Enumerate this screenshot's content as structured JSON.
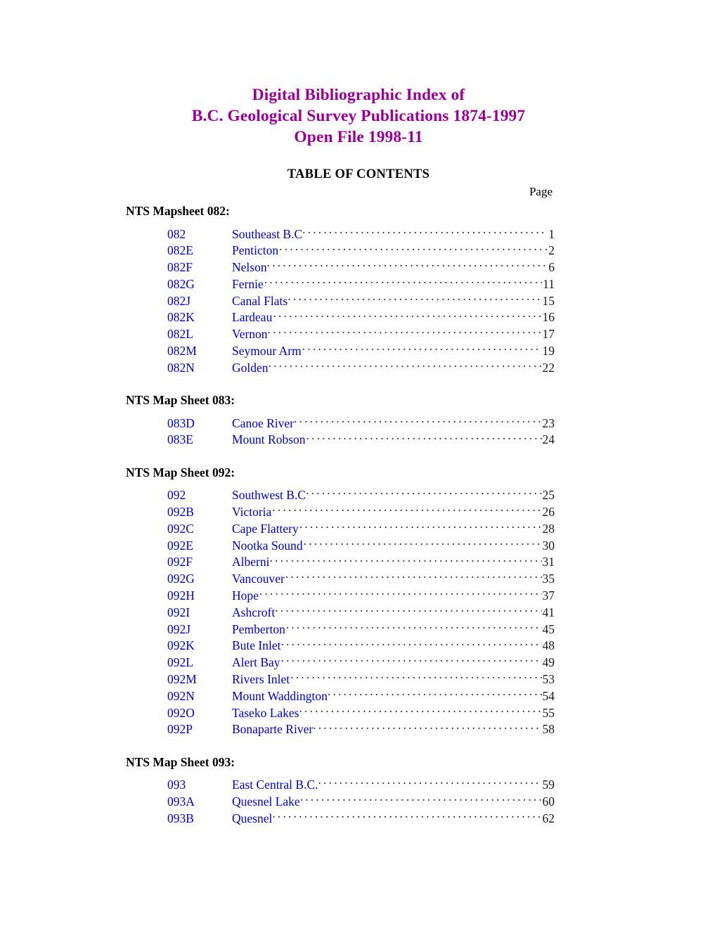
{
  "document": {
    "title_lines": [
      "Digital Bibliographic Index of",
      "B.C. Geological Survey Publications 1874-1997",
      "Open File 1998-11"
    ],
    "toc_heading": "TABLE OF CONTENTS",
    "page_column_label": "Page",
    "colors": {
      "title": "#990099",
      "link": "#0000CC",
      "text": "#000000",
      "leader": "#2B2B2B"
    }
  },
  "sections": [
    {
      "heading": "NTS Mapsheet  082:",
      "entries": [
        {
          "code": "082",
          "name": "Southeast B.C",
          "leader_space": false,
          "page": "1"
        },
        {
          "code": "082E",
          "name": "Penticton",
          "leader_space": true,
          "page": "2"
        },
        {
          "code": "082F",
          "name": "Nelson",
          "leader_space": false,
          "page": "6"
        },
        {
          "code": "082G",
          "name": "Fernie",
          "leader_space": true,
          "page": "11"
        },
        {
          "code": "082J",
          "name": "Canal Flats",
          "leader_space": false,
          "page": "15"
        },
        {
          "code": "082K",
          "name": "Lardeau",
          "leader_space": true,
          "page": "16"
        },
        {
          "code": "082L",
          "name": "Vernon",
          "leader_space": false,
          "page": "17"
        },
        {
          "code": "082M",
          "name": "Seymour Arm",
          "leader_space": true,
          "page": "19"
        },
        {
          "code": "082N",
          "name": "Golden",
          "leader_space": false,
          "page": "22"
        }
      ]
    },
    {
      "heading": "NTS Map Sheet  083:",
      "entries": [
        {
          "code": "083D",
          "name": "Canoe River",
          "leader_space": false,
          "page": "23"
        },
        {
          "code": "083E",
          "name": "Mount Robson",
          "leader_space": true,
          "page": "24"
        }
      ]
    },
    {
      "heading": "NTS Map Sheet  092:",
      "entries": [
        {
          "code": "092",
          "name": "Southwest B.C",
          "leader_space": false,
          "page": "25"
        },
        {
          "code": "092B",
          "name": "Victoria",
          "leader_space": true,
          "page": "26"
        },
        {
          "code": "092C",
          "name": "Cape Flattery",
          "leader_space": true,
          "page": "28"
        },
        {
          "code": "092E",
          "name": "Nootka Sound",
          "leader_space": true,
          "page": "30"
        },
        {
          "code": "092F",
          "name": "Alberni",
          "leader_space": false,
          "page": "31"
        },
        {
          "code": "092G",
          "name": "Vancouver",
          "leader_space": true,
          "page": "35"
        },
        {
          "code": "092H",
          "name": "Hope",
          "leader_space": true,
          "page": "37"
        },
        {
          "code": "092I",
          "name": "Ashcroft",
          "leader_space": false,
          "page": "41"
        },
        {
          "code": "092J",
          "name": "Pemberton",
          "leader_space": true,
          "page": "45"
        },
        {
          "code": "092K",
          "name": "Bute Inlet",
          "leader_space": false,
          "page": "48"
        },
        {
          "code": "092L",
          "name": "Alert Bay",
          "leader_space": true,
          "page": "49"
        },
        {
          "code": "092M",
          "name": "Rivers Inlet",
          "leader_space": true,
          "page": "53"
        },
        {
          "code": "092N",
          "name": "Mount Waddington",
          "leader_space": false,
          "page": "54"
        },
        {
          "code": "092O",
          "name": "Taseko Lakes",
          "leader_space": false,
          "page": "55"
        },
        {
          "code": "092P",
          "name": "Bonaparte River",
          "leader_space": false,
          "page": "58"
        }
      ]
    },
    {
      "heading": "NTS Map Sheet  093:",
      "entries": [
        {
          "code": "093",
          "name": "East Central B.C.",
          "leader_space": false,
          "page": "59"
        },
        {
          "code": "093A",
          "name": "Quesnel Lake",
          "leader_space": false,
          "page": "60"
        },
        {
          "code": "093B",
          "name": "Quesnel",
          "leader_space": false,
          "page": "62"
        }
      ]
    }
  ]
}
